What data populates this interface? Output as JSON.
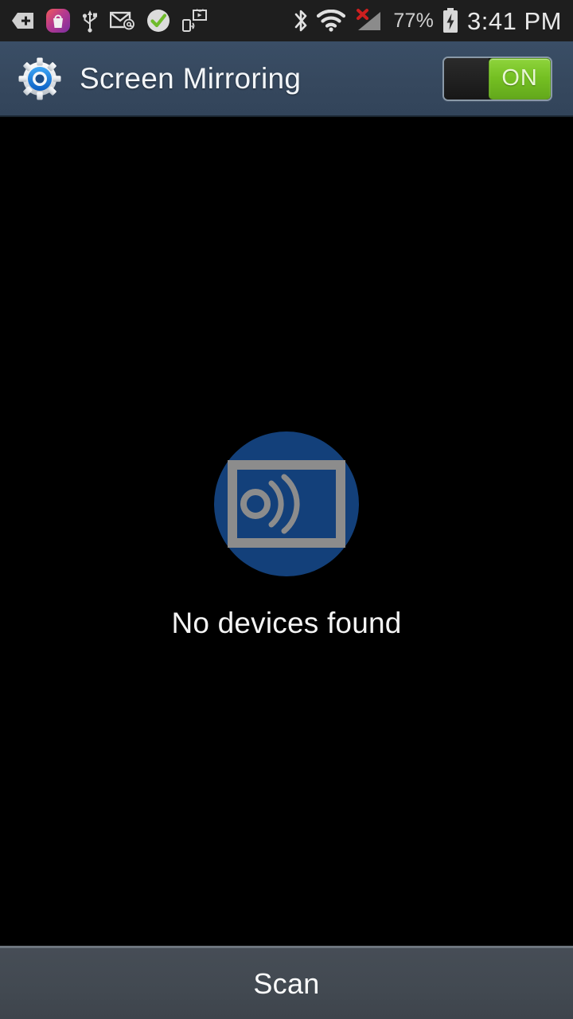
{
  "status_bar": {
    "background": "#1e1e1e",
    "left_icons": [
      {
        "name": "more-notifications-icon",
        "label": "+"
      },
      {
        "name": "galaxy-apps-icon",
        "label": "Galaxy Apps"
      },
      {
        "name": "usb-icon",
        "label": "USB connected"
      },
      {
        "name": "email-icon",
        "label": "New email"
      },
      {
        "name": "checkmark-icon",
        "label": "Complete"
      },
      {
        "name": "screen-mirroring-status-icon",
        "label": "Screen Mirroring"
      }
    ],
    "right_icons": [
      {
        "name": "bluetooth-icon",
        "label": "Bluetooth"
      },
      {
        "name": "wifi-icon",
        "label": "Wi-Fi"
      },
      {
        "name": "cellular-signal-icon",
        "label": "No service"
      }
    ],
    "battery_percent": "77%",
    "battery_charging": true,
    "clock": "3:41 PM"
  },
  "header": {
    "title": "Screen Mirroring",
    "icon": "settings-gear-icon",
    "background": "#36485e",
    "toggle": {
      "state_label": "ON",
      "is_on": true,
      "on_color": "#74bf22"
    }
  },
  "content": {
    "background": "#000000",
    "badge_icon": "screen-mirroring-icon",
    "badge_color": "#13407a",
    "badge_glyph_color": "#8c8c8c",
    "empty_state_text": "No devices found"
  },
  "bottom_bar": {
    "scan_label": "Scan",
    "background": "#424951"
  }
}
